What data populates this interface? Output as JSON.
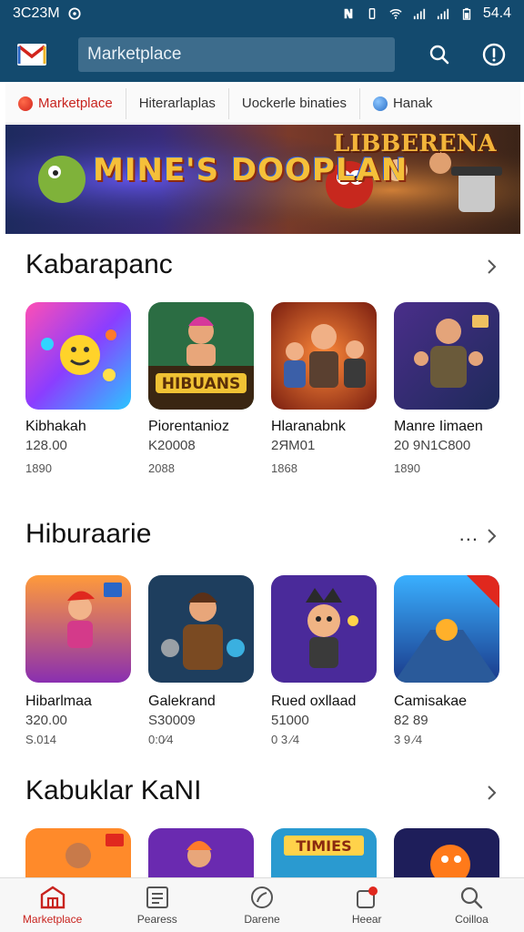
{
  "status_bar": {
    "time": "3C23M",
    "battery": "54.4"
  },
  "app_bar": {
    "search_placeholder": "Marketplace"
  },
  "tabs": [
    {
      "label": "Marketplace",
      "active": true,
      "dot_color": "#e0281e"
    },
    {
      "label": "Hiterarlaplas",
      "active": false
    },
    {
      "label": "Uockerle binaties",
      "active": false
    },
    {
      "label": "Hanak",
      "active": false,
      "dot_color": "#3a8ad9"
    }
  ],
  "banner": {
    "left_title": "MINE'S DOOPLAN",
    "right_title": "LIBBERENA"
  },
  "sections": [
    {
      "title": "Kabarapanc",
      "has_more": false,
      "items": [
        {
          "name": "Kibhakah",
          "sub": "128.00",
          "meta": "1890"
        },
        {
          "name": "Piorentanioz",
          "sub": "K20008",
          "meta": "2088"
        },
        {
          "name": "Hlaranabnk",
          "sub": "2ЯM01",
          "meta": "1868"
        },
        {
          "name": "Manre Iimaen",
          "sub": "20 9N1C800",
          "meta": "1890"
        }
      ]
    },
    {
      "title": "Hiburaarie",
      "has_more": true,
      "more_label": "...",
      "items": [
        {
          "name": "Hibarlmaa",
          "sub": "320.00",
          "meta": "S.014"
        },
        {
          "name": "Galekrand",
          "sub": "S30009",
          "meta": "0:0⁄4"
        },
        {
          "name": "Rued oxllaad",
          "sub": "51000",
          "meta": "0 3 ⁄4"
        },
        {
          "name": "Camisakae",
          "sub": "82 89",
          "meta": "3 9 ⁄4"
        }
      ]
    },
    {
      "title": "Kabuklar KaNI",
      "has_more": false,
      "items": [
        {
          "name": "",
          "sub": "",
          "meta": ""
        },
        {
          "name": "",
          "sub": "",
          "meta": ""
        },
        {
          "name": "",
          "sub": "",
          "meta": ""
        },
        {
          "name": "",
          "sub": "",
          "meta": ""
        }
      ]
    }
  ],
  "bottom_nav": [
    {
      "label": "Marketplace",
      "icon": "store-icon",
      "active": true
    },
    {
      "label": "Pearess",
      "icon": "list-icon",
      "active": false
    },
    {
      "label": "Darene",
      "icon": "compass-icon",
      "active": false
    },
    {
      "label": "Heear",
      "icon": "notification-icon",
      "active": false
    },
    {
      "label": "Coilloa",
      "icon": "search-icon",
      "active": false
    }
  ],
  "colors": {
    "primary": "#134a6e",
    "accent": "#c8231e"
  }
}
